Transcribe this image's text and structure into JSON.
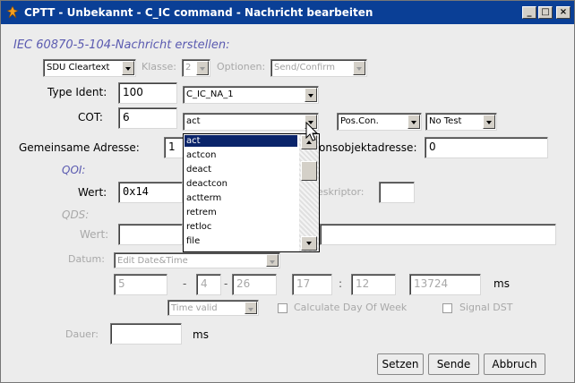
{
  "window": {
    "title": "CPTT - Unbekannt - C_IC command - Nachricht bearbeiten",
    "minimize": "_",
    "maximize": "□",
    "close": "×"
  },
  "header": "IEC 60870-5-104-Nachricht erstellen:",
  "top_row": {
    "format_value": "SDU Cleartext",
    "klasse_label": "Klasse:",
    "klasse_value": "2",
    "optionen_label": "Optionen:",
    "optionen_value": "Send/Confirm"
  },
  "type_ident": {
    "label": "Type Ident:",
    "value": "100",
    "name_value": "C_IC_NA_1"
  },
  "cot": {
    "label": "COT:",
    "value": "6",
    "combo_value": "act",
    "pos_con": "Pos.Con.",
    "test": "No Test"
  },
  "address": {
    "label": "Gemeinsame Adresse:",
    "value": "1",
    "info_label": "Informationsobjektadresse:",
    "info_label_visible": "onsobjektadresse:",
    "info_value": "0"
  },
  "qoi": {
    "section": "QOI:",
    "wert_label": "Wert:",
    "wert_value": "0x14",
    "deskriptor_label": "Deskriptor:",
    "deskriptor_visible": "eskriptor:"
  },
  "qds": {
    "section": "QDS:",
    "wert_label": "Wert:"
  },
  "datum": {
    "label": "Datum:",
    "combo_value": "Edit Date&Time",
    "year": "5",
    "month": "4",
    "day": "26",
    "hour": "17",
    "minute": "12",
    "ms": "13724",
    "dash1": "-",
    "dash2": "-",
    "colon": ":",
    "ms_label": "ms",
    "time_valid": "Time valid",
    "calc_dow": "Calculate Day Of Week",
    "signal_dst": "Signal DST"
  },
  "dauer": {
    "label": "Dauer:",
    "unit": "ms"
  },
  "buttons": {
    "setzen": "Setzen",
    "sende": "Sende",
    "abbruch": "Abbruch"
  },
  "cot_dropdown": {
    "options": [
      "act",
      "actcon",
      "deact",
      "deactcon",
      "actterm",
      "retrem",
      "retloc",
      "file"
    ],
    "selected": "act"
  },
  "colors": {
    "titlebar": "#0a3f96",
    "selection": "#0a246a",
    "section_label": "#5a5ab0",
    "disabled_text": "#a8a8a8"
  }
}
